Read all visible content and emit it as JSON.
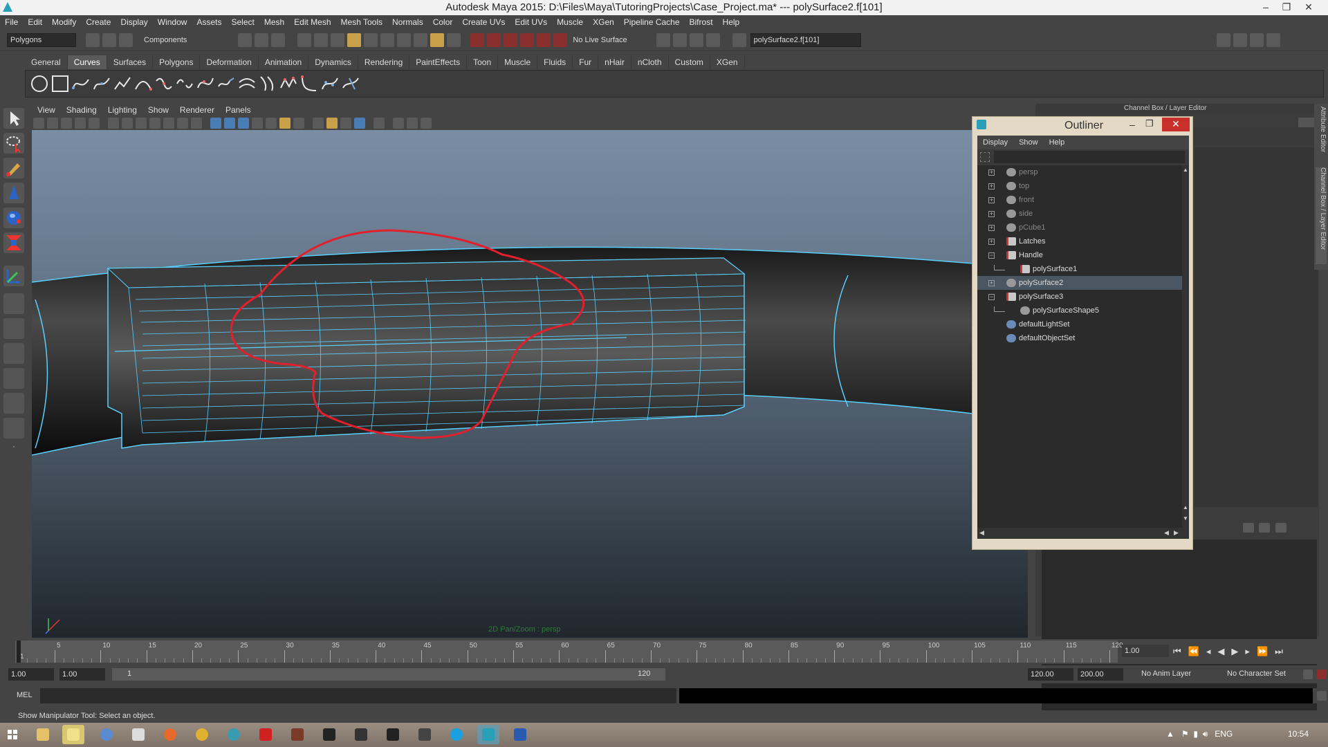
{
  "window": {
    "title": "Autodesk Maya 2015: D:\\Files\\Maya\\TutoringProjects\\Case_Project.ma*   ---   polySurface2.f[101]",
    "controls": {
      "minimize": "–",
      "maximize": "❐",
      "close": "✕"
    }
  },
  "menubar": [
    "File",
    "Edit",
    "Modify",
    "Create",
    "Display",
    "Window",
    "Assets",
    "Select",
    "Mesh",
    "Edit Mesh",
    "Mesh Tools",
    "Normals",
    "Color",
    "Create UVs",
    "Edit UVs",
    "Muscle",
    "XGen",
    "Pipeline Cache",
    "Bifrost",
    "Help"
  ],
  "statusline": {
    "mode": "Polygons",
    "components": "Components",
    "live_surface": "No Live Surface",
    "selection_field": "polySurface2.f[101]"
  },
  "shelf": {
    "tabs": [
      "General",
      "Curves",
      "Surfaces",
      "Polygons",
      "Deformation",
      "Animation",
      "Dynamics",
      "Rendering",
      "PaintEffects",
      "Toon",
      "Muscle",
      "Fluids",
      "Fur",
      "nHair",
      "nCloth",
      "Custom",
      "XGen"
    ],
    "active_tab": "Curves"
  },
  "viewport": {
    "menu": [
      "View",
      "Shading",
      "Lighting",
      "Show",
      "Renderer",
      "Panels"
    ],
    "camera_label": "2D Pan/Zoom : persp"
  },
  "channel_box": {
    "header": "Channel Box / Layer Editor",
    "side_tabs": [
      "Attribute Editor",
      "Channel Box / Layer Editor"
    ]
  },
  "outliner": {
    "title": "Outliner",
    "menu": [
      "Display",
      "Show",
      "Help"
    ],
    "items": [
      {
        "label": "persp",
        "indent": 0,
        "expand": "+",
        "dim": true,
        "icon": "camera"
      },
      {
        "label": "top",
        "indent": 0,
        "expand": "+",
        "dim": true,
        "icon": "camera"
      },
      {
        "label": "front",
        "indent": 0,
        "expand": "+",
        "dim": true,
        "icon": "camera"
      },
      {
        "label": "side",
        "indent": 0,
        "expand": "+",
        "dim": true,
        "icon": "camera"
      },
      {
        "label": "pCube1",
        "indent": 0,
        "expand": "+",
        "dim": true,
        "icon": "mesh"
      },
      {
        "label": "Latches",
        "indent": 0,
        "expand": "+",
        "dim": false,
        "icon": "group"
      },
      {
        "label": "Handle",
        "indent": 0,
        "expand": "−",
        "dim": false,
        "icon": "group"
      },
      {
        "label": "polySurface1",
        "indent": 1,
        "expand": "",
        "dim": false,
        "icon": "group"
      },
      {
        "label": "polySurface2",
        "indent": 0,
        "expand": "+",
        "dim": false,
        "icon": "mesh",
        "selected": true
      },
      {
        "label": "polySurface3",
        "indent": 0,
        "expand": "−",
        "dim": false,
        "icon": "group"
      },
      {
        "label": "polySurfaceShape5",
        "indent": 1,
        "expand": "",
        "dim": false,
        "icon": "mesh"
      },
      {
        "label": "defaultLightSet",
        "indent": 0,
        "expand": "",
        "dim": false,
        "icon": "set"
      },
      {
        "label": "defaultObjectSet",
        "indent": 0,
        "expand": "",
        "dim": false,
        "icon": "set"
      }
    ]
  },
  "timeline": {
    "ticks": [
      "1",
      "5",
      "10",
      "15",
      "20",
      "25",
      "30",
      "35",
      "40",
      "45",
      "50",
      "55",
      "60",
      "65",
      "70",
      "75",
      "80",
      "85",
      "90",
      "95",
      "100",
      "105",
      "110",
      "115",
      "120"
    ],
    "current_frame": "1.00",
    "start": "1.00",
    "start2": "1.00",
    "range_start": "1",
    "range_end": "120",
    "end": "120.00",
    "end2": "200.00",
    "anim_layer": "No Anim Layer",
    "character_set": "No Character Set"
  },
  "mel_label": "MEL",
  "help_line": "Show Manipulator Tool: Select an object.",
  "taskbar": {
    "language": "ENG",
    "time": "10:54"
  }
}
